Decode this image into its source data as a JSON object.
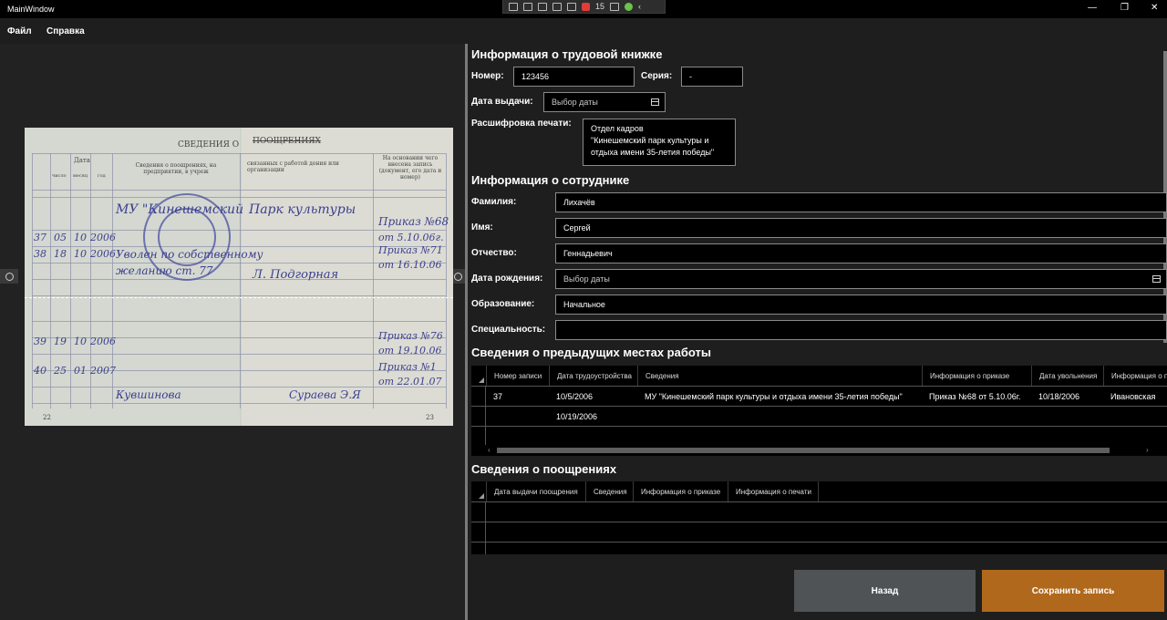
{
  "window": {
    "title": "MainWindow",
    "minimize": "—",
    "maximize": "❐",
    "close": "✕"
  },
  "debug_toolbar": {
    "count": "15"
  },
  "menu": {
    "file": "Файл",
    "help": "Справка"
  },
  "document_image": {
    "printed": {
      "heading": "СВЕДЕНИЯ О",
      "heading_word": "ПООЩРЕНИЯХ",
      "col_date": "Дата",
      "col_day": "число",
      "col_month": "месяц",
      "col_year": "год",
      "col_info": "Сведения о поощрениях, на предприятии, в учреж",
      "col_related": "связанных с работой дения или организации",
      "col_basis": "На основании чего внесена запись (документ, его дата и номер)",
      "page_left": "22",
      "page_right": "23"
    },
    "handwritten": [
      "МУ \"Кинешемский",
      "Парк культуры",
      "Приказ №68",
      "от 5.10.06г.",
      "37",
      "05",
      "10",
      "2006",
      "Уволен по собственному",
      "желанию ст. 77",
      "Л. Подгорная",
      "38",
      "18",
      "10",
      "2006",
      "Приказ №71",
      "от 16.10.06",
      "39",
      "19",
      "10",
      "2006",
      "Приказ №76",
      "от 19.10.06",
      "40",
      "25",
      "01",
      "2007",
      "Приказ №1",
      "от 22.01.07",
      "Кувшинова",
      "Сураева Э.Я"
    ]
  },
  "work_book": {
    "heading": "Информация о трудовой книжке",
    "number_label": "Номер:",
    "number_value": "123456",
    "series_label": "Серия:",
    "series_value": "-",
    "issue_date_label": "Дата выдачи:",
    "issue_date_placeholder": "Выбор даты",
    "stamp_label": "Расшифровка печати:",
    "stamp_lines": [
      "Отдел кадров",
      "\"Кинешемский парк культуры и",
      "отдыха имени 35-летия победы\""
    ]
  },
  "employee": {
    "heading": "Информация о сотруднике",
    "last_name_label": "Фамилия:",
    "last_name": "Лихачёв",
    "first_name_label": "Имя:",
    "first_name": "Сергей",
    "patronymic_label": "Отчество:",
    "patronymic": "Геннадьевич",
    "birth_date_label": "Дата рождения:",
    "birth_date_placeholder": "Выбор даты",
    "education_label": "Образование:",
    "education": "Начальное",
    "specialty_label": "Специальность:",
    "specialty": ""
  },
  "jobs": {
    "heading": "Сведения о предыдущих местах работы",
    "columns": [
      "Номер записи",
      "Дата трудоустройства",
      "Сведения",
      "Информация о приказе",
      "Дата увольнения",
      "Информация о п"
    ],
    "rows": [
      [
        "37",
        "10/5/2006",
        "МУ \"Кинешемский парк культуры и отдыха имени 35-летия победы\"",
        "Приказ №68 от 5.10.06г.",
        "10/18/2006",
        "Ивановская"
      ],
      [
        "",
        "10/19/2006",
        "",
        "",
        "",
        ""
      ]
    ]
  },
  "awards": {
    "heading": "Сведения о поощрениях",
    "columns": [
      "Дата выдачи поощрения",
      "Сведения",
      "Информация о приказе",
      "Информация о печати"
    ]
  },
  "buttons": {
    "back": "Назад",
    "save": "Сохранить запись"
  },
  "colors": {
    "save_accent": "#b0681c",
    "back_gray": "#4f5356"
  }
}
